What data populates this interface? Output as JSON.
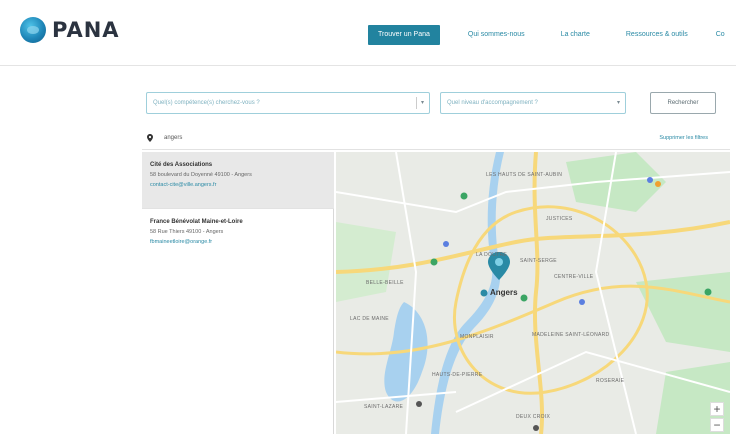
{
  "header": {
    "logo_text": "PANA",
    "nav": [
      {
        "label": "Trouver un Pana",
        "active": true
      },
      {
        "label": "Qui sommes-nous",
        "active": false
      },
      {
        "label": "La charte",
        "active": false
      },
      {
        "label": "Ressources & outils",
        "active": false
      },
      {
        "label": "Co",
        "active": false
      }
    ]
  },
  "search": {
    "skills_placeholder": "Quel(s) compétence(s) cherchez-vous ?",
    "level_placeholder": "Quel niveau d'accompagnement ?",
    "search_button": "Rechercher"
  },
  "location": {
    "value": "angers",
    "clear_label": "Supprimer les filtres"
  },
  "results": [
    {
      "name": "Cité des Associations",
      "address": "58 boulevard du Doyenné 49100 - Angers",
      "email": "contact-cite@ville.angers.fr",
      "selected": true
    },
    {
      "name": "France Bénévolat Maine-et-Loire",
      "address": "58 Rue Thiers 49100 - Angers",
      "email": "fbmaineetloire@orange.fr",
      "selected": false
    }
  ],
  "map": {
    "city_label": "Angers",
    "labels": [
      "LES HAUTS DE SAINT-AUBIN",
      "LA DOUTRE",
      "BELLE-BEILLE",
      "SAINT-SERGE",
      "CENTRE-VILLE",
      "JUSTICES",
      "MADELEINE SAINT-LÉONARD",
      "MONPLAISIR",
      "HAUTS-DE-PIERRE",
      "LAC DE MAINE",
      "SAINT-LAZARE",
      "ROSERAIE",
      "DEUX CROIX"
    ],
    "zoom_in": "+",
    "zoom_out": "−",
    "colors": {
      "water": "#a8d1ef",
      "park": "#c6e8c4",
      "road_major": "#f7d87a",
      "road": "#ffffff",
      "marker": "#2a8aa5"
    }
  }
}
